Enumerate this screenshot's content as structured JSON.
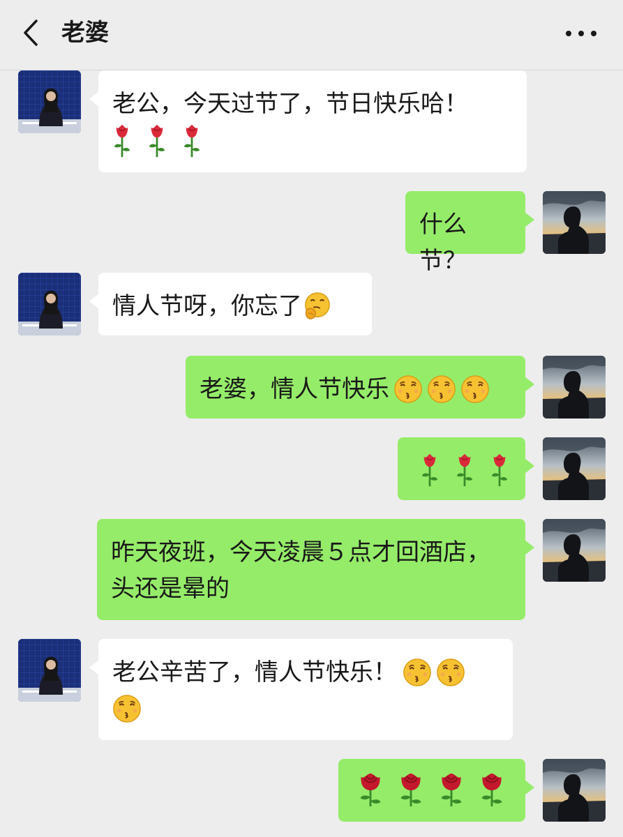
{
  "header": {
    "title": "老婆"
  },
  "messages": [
    {
      "from": "her",
      "text": "老公，今天过节了，节日快乐哈！",
      "icons": [
        "rose-icon",
        "rose-icon",
        "rose-icon"
      ]
    },
    {
      "from": "me",
      "text": "什么节？"
    },
    {
      "from": "her",
      "text": "情人节呀，你忘了",
      "icons": [
        "thinking-face-icon"
      ]
    },
    {
      "from": "me",
      "text": "老婆，情人节快乐",
      "icons": [
        "kissing-face-icon",
        "kissing-face-icon",
        "kissing-face-icon"
      ]
    },
    {
      "from": "me",
      "text": "",
      "icons": [
        "rose-icon",
        "rose-icon",
        "rose-icon"
      ]
    },
    {
      "from": "me",
      "text_line1": "昨天夜班，今天凌晨５点才回酒店，",
      "text_line2": "头还是晕的"
    },
    {
      "from": "her",
      "text": "老公辛苦了，情人节快乐！",
      "icons": [
        "kissing-face-icon",
        "kissing-face-icon",
        "kissing-face-icon"
      ]
    },
    {
      "from": "me",
      "text": "",
      "icons": [
        "red-rose-icon",
        "red-rose-icon",
        "red-rose-icon",
        "red-rose-icon"
      ]
    }
  ],
  "colors": {
    "background": "#ededed",
    "incoming_bubble": "#ffffff",
    "outgoing_bubble": "#95ec69",
    "text": "#191919"
  }
}
